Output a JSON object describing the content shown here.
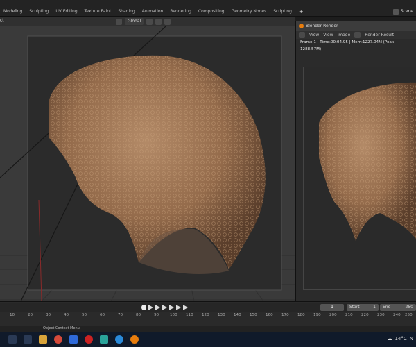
{
  "topbar": {
    "tabs": [
      "Modeling",
      "Sculpting",
      "UV Editing",
      "Texture Paint",
      "Shading",
      "Animation",
      "Rendering",
      "Compositing",
      "Geometry Nodes",
      "Scripting"
    ],
    "add_tab": "+",
    "scene_label": "Scene"
  },
  "viewport": {
    "mode_label": "ct",
    "orientation": "Global"
  },
  "render_window": {
    "title": "Blender Render",
    "menu": [
      "View",
      "View",
      "Image"
    ],
    "slot": "Render Result",
    "stats": "Frame:1 | Time:00:04.95 | Mem:1227.04M (Peak 1288.57M)"
  },
  "timeline": {
    "current_frame": "1",
    "start_label": "Start",
    "start_value": "1",
    "end_label": "End",
    "end_value": "250",
    "ruler": [
      "10",
      "20",
      "30",
      "40",
      "50",
      "60",
      "70",
      "80",
      "90",
      "100",
      "110",
      "120",
      "130",
      "140",
      "150",
      "160",
      "170",
      "180",
      "190",
      "200",
      "210",
      "220",
      "230",
      "240",
      "250"
    ]
  },
  "status": {
    "message": "Object Context Menu"
  },
  "taskbar": {
    "temperature": "14°C",
    "extra": "N"
  },
  "colors": {
    "accent": "#e87d0d",
    "hair": "#9b7352",
    "bg": "#1d1d1d"
  }
}
